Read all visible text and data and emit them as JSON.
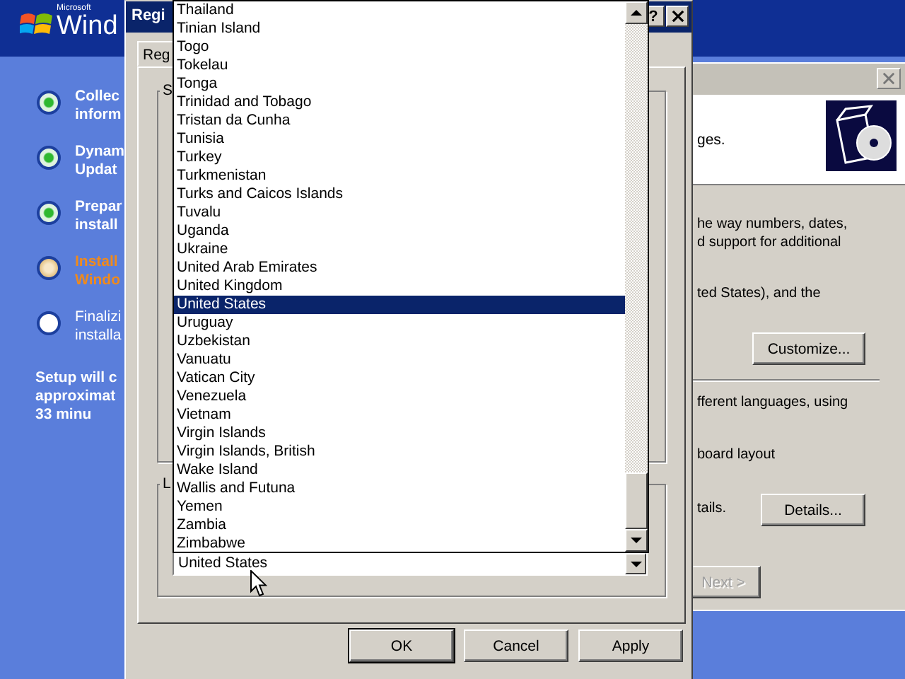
{
  "banner": {
    "logo_small": "Microsoft",
    "logo": "Wind"
  },
  "steps": [
    {
      "lines": [
        "Collec",
        "inform"
      ],
      "kind": "done"
    },
    {
      "lines": [
        "Dynam",
        "Updat"
      ],
      "kind": "done"
    },
    {
      "lines": [
        "Prepar",
        "install"
      ],
      "kind": "done"
    },
    {
      "lines": [
        "Install",
        "Windo"
      ],
      "kind": "current"
    },
    {
      "lines": [
        "Finalizi",
        "installa"
      ],
      "kind": "pending"
    }
  ],
  "time_note": [
    "Setup will c",
    "approximat",
    "33 minu"
  ],
  "wizard": {
    "header_text": "ges.",
    "texts": [
      "he way numbers, dates,",
      "d support for additional",
      "ted States), and the",
      "fferent languages, using",
      "board layout",
      "tails."
    ],
    "buttons": [
      {
        "label": "Customize...",
        "disabled": false
      },
      {
        "label": "Details...",
        "disabled": false
      },
      {
        "label": "Next >",
        "disabled": true
      }
    ]
  },
  "dialog": {
    "title": "Regi",
    "help": "?",
    "tab": "Reg",
    "groups": [
      "S",
      "L"
    ],
    "combo_value": "United States",
    "buttons": [
      {
        "label": "OK",
        "default": true
      },
      {
        "label": "Cancel",
        "default": false
      },
      {
        "label": "Apply",
        "default": false
      }
    ]
  },
  "country_list": [
    {
      "label": "Thailand",
      "selected": false
    },
    {
      "label": "Tinian Island",
      "selected": false
    },
    {
      "label": "Togo",
      "selected": false
    },
    {
      "label": "Tokelau",
      "selected": false
    },
    {
      "label": "Tonga",
      "selected": false
    },
    {
      "label": "Trinidad and Tobago",
      "selected": false
    },
    {
      "label": "Tristan da Cunha",
      "selected": false
    },
    {
      "label": "Tunisia",
      "selected": false
    },
    {
      "label": "Turkey",
      "selected": false
    },
    {
      "label": "Turkmenistan",
      "selected": false
    },
    {
      "label": "Turks and Caicos Islands",
      "selected": false
    },
    {
      "label": "Tuvalu",
      "selected": false
    },
    {
      "label": "Uganda",
      "selected": false
    },
    {
      "label": "Ukraine",
      "selected": false
    },
    {
      "label": "United Arab Emirates",
      "selected": false
    },
    {
      "label": "United Kingdom",
      "selected": false
    },
    {
      "label": "United States",
      "selected": true
    },
    {
      "label": "Uruguay",
      "selected": false
    },
    {
      "label": "Uzbekistan",
      "selected": false
    },
    {
      "label": "Vanuatu",
      "selected": false
    },
    {
      "label": "Vatican City",
      "selected": false
    },
    {
      "label": "Venezuela",
      "selected": false
    },
    {
      "label": "Vietnam",
      "selected": false
    },
    {
      "label": "Virgin Islands",
      "selected": false
    },
    {
      "label": "Virgin Islands, British",
      "selected": false
    },
    {
      "label": "Wake Island",
      "selected": false
    },
    {
      "label": "Wallis and Futuna",
      "selected": false
    },
    {
      "label": "Yemen",
      "selected": false
    },
    {
      "label": "Zambia",
      "selected": false
    },
    {
      "label": "Zimbabwe",
      "selected": false
    }
  ]
}
